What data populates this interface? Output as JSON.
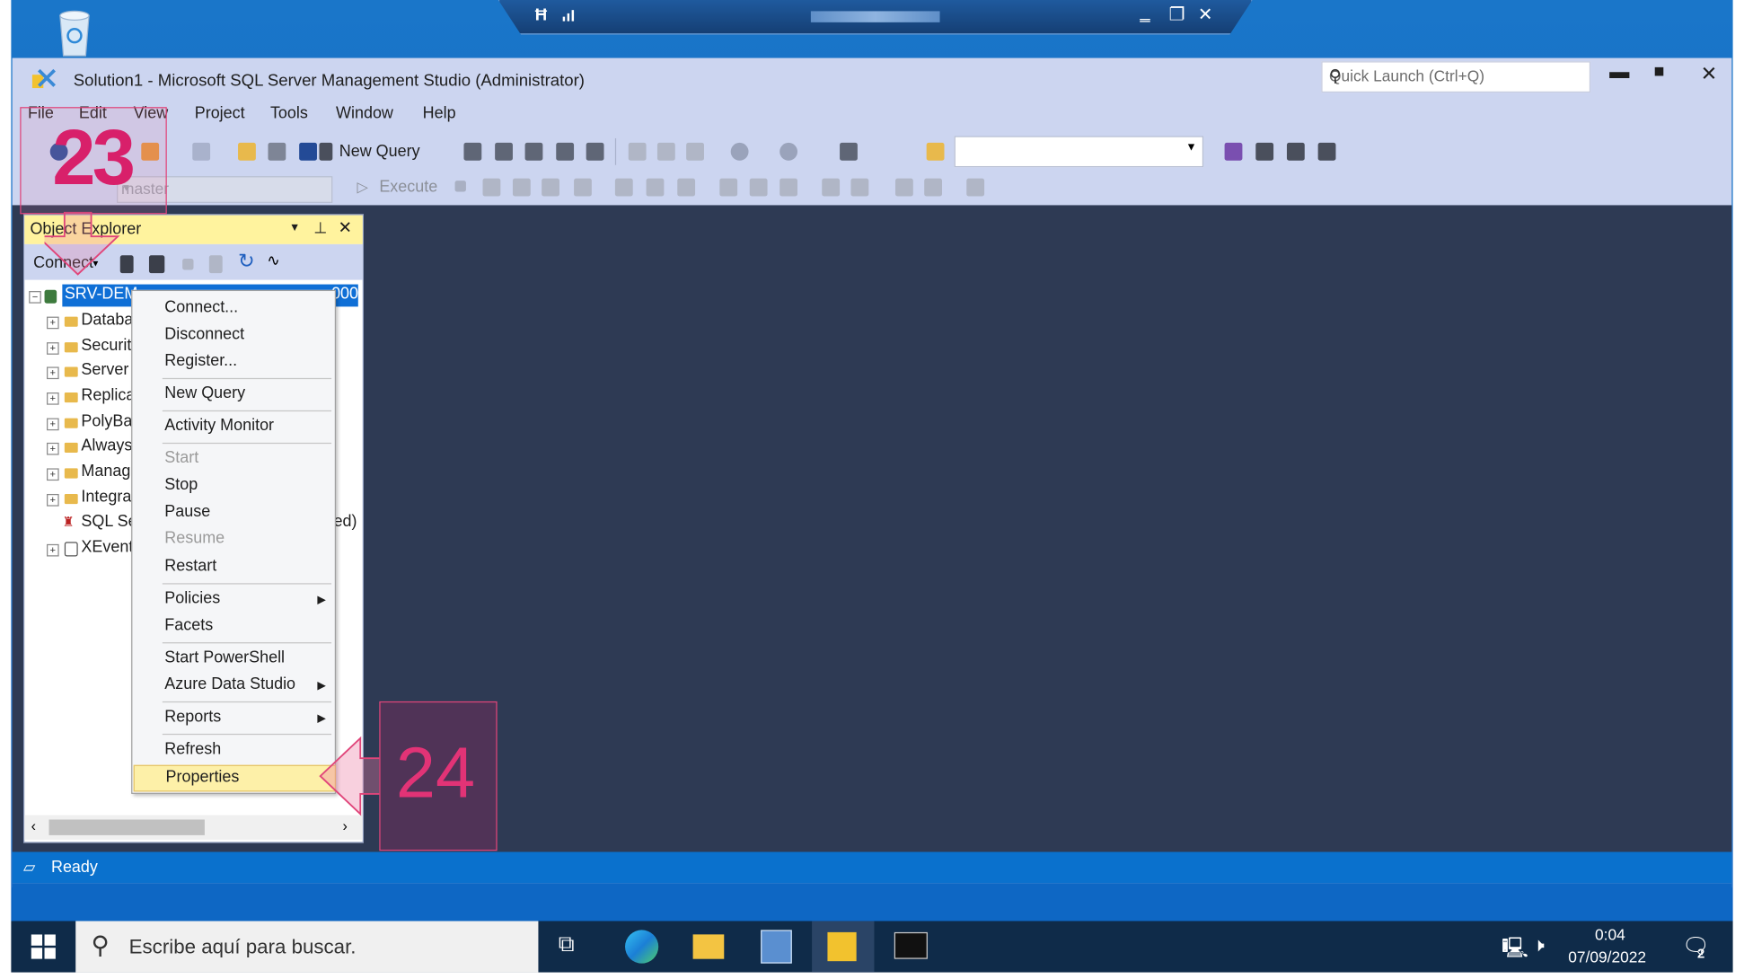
{
  "remote_bar": {
    "minimize": "‗",
    "restore": "❐",
    "close": "✕"
  },
  "window": {
    "title": "Solution1 - Microsoft SQL Server Management Studio (Administrator)",
    "quick_launch_placeholder": "Quick Launch (Ctrl+Q)",
    "minimize": "▬",
    "maximize": "■",
    "close": "✕"
  },
  "menu": [
    "File",
    "Edit",
    "View",
    "Project",
    "Tools",
    "Window",
    "Help"
  ],
  "toolbar": {
    "new_query": "New Query",
    "database": "master",
    "execute": "Execute"
  },
  "object_explorer": {
    "title": "Object Explorer",
    "connect": "Connect",
    "server_label": "SRV-DEM",
    "server_suffix": "000",
    "tree_items": [
      "Databa",
      "Securit",
      "Server",
      "Replica",
      "PolyBa",
      "Always",
      "Manag",
      "Integra",
      "SQL Se",
      "XEvent"
    ],
    "sql_agent_suffix": "ed)"
  },
  "context_menu": {
    "items": [
      {
        "label": "Connect...",
        "enabled": true
      },
      {
        "label": "Disconnect",
        "enabled": true
      },
      {
        "label": "Register...",
        "enabled": true
      },
      {
        "label": "New Query",
        "enabled": true
      },
      {
        "label": "Activity Monitor",
        "enabled": true
      },
      {
        "label": "Start",
        "enabled": false
      },
      {
        "label": "Stop",
        "enabled": true
      },
      {
        "label": "Pause",
        "enabled": true
      },
      {
        "label": "Resume",
        "enabled": false
      },
      {
        "label": "Restart",
        "enabled": true
      },
      {
        "label": "Policies",
        "enabled": true,
        "submenu": true
      },
      {
        "label": "Facets",
        "enabled": true
      },
      {
        "label": "Start PowerShell",
        "enabled": true
      },
      {
        "label": "Azure Data Studio",
        "enabled": true,
        "submenu": true
      },
      {
        "label": "Reports",
        "enabled": true,
        "submenu": true
      },
      {
        "label": "Refresh",
        "enabled": true
      },
      {
        "label": "Properties",
        "enabled": true,
        "highlighted": true
      }
    ]
  },
  "callouts": {
    "step_a": "23",
    "step_b": "24"
  },
  "status": {
    "text": "Ready"
  },
  "taskbar": {
    "search_placeholder": "Escribe aquí para buscar.",
    "time": "0:04",
    "date": "07/09/2022",
    "notifications": "2"
  },
  "colors": {
    "accent": "#0a71cd",
    "doc_bg": "#2e3a54",
    "selection": "#0f6fd6",
    "callout": "#d8206a"
  }
}
